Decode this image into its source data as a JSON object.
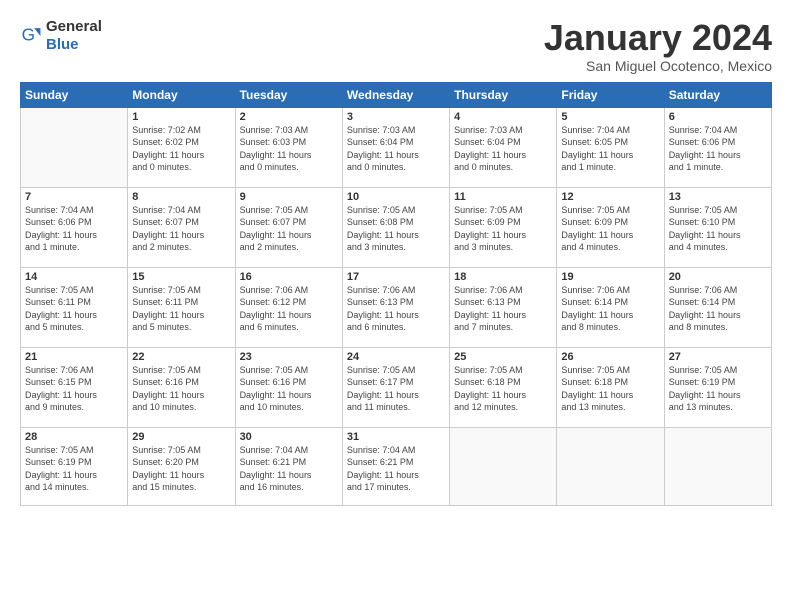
{
  "logo": {
    "general": "General",
    "blue": "Blue"
  },
  "title": "January 2024",
  "subtitle": "San Miguel Ocotenco, Mexico",
  "weekdays": [
    "Sunday",
    "Monday",
    "Tuesday",
    "Wednesday",
    "Thursday",
    "Friday",
    "Saturday"
  ],
  "weeks": [
    [
      {
        "day": "",
        "info": ""
      },
      {
        "day": "1",
        "info": "Sunrise: 7:02 AM\nSunset: 6:02 PM\nDaylight: 11 hours\nand 0 minutes."
      },
      {
        "day": "2",
        "info": "Sunrise: 7:03 AM\nSunset: 6:03 PM\nDaylight: 11 hours\nand 0 minutes."
      },
      {
        "day": "3",
        "info": "Sunrise: 7:03 AM\nSunset: 6:04 PM\nDaylight: 11 hours\nand 0 minutes."
      },
      {
        "day": "4",
        "info": "Sunrise: 7:03 AM\nSunset: 6:04 PM\nDaylight: 11 hours\nand 0 minutes."
      },
      {
        "day": "5",
        "info": "Sunrise: 7:04 AM\nSunset: 6:05 PM\nDaylight: 11 hours\nand 1 minute."
      },
      {
        "day": "6",
        "info": "Sunrise: 7:04 AM\nSunset: 6:06 PM\nDaylight: 11 hours\nand 1 minute."
      }
    ],
    [
      {
        "day": "7",
        "info": "Sunrise: 7:04 AM\nSunset: 6:06 PM\nDaylight: 11 hours\nand 1 minute."
      },
      {
        "day": "8",
        "info": "Sunrise: 7:04 AM\nSunset: 6:07 PM\nDaylight: 11 hours\nand 2 minutes."
      },
      {
        "day": "9",
        "info": "Sunrise: 7:05 AM\nSunset: 6:07 PM\nDaylight: 11 hours\nand 2 minutes."
      },
      {
        "day": "10",
        "info": "Sunrise: 7:05 AM\nSunset: 6:08 PM\nDaylight: 11 hours\nand 3 minutes."
      },
      {
        "day": "11",
        "info": "Sunrise: 7:05 AM\nSunset: 6:09 PM\nDaylight: 11 hours\nand 3 minutes."
      },
      {
        "day": "12",
        "info": "Sunrise: 7:05 AM\nSunset: 6:09 PM\nDaylight: 11 hours\nand 4 minutes."
      },
      {
        "day": "13",
        "info": "Sunrise: 7:05 AM\nSunset: 6:10 PM\nDaylight: 11 hours\nand 4 minutes."
      }
    ],
    [
      {
        "day": "14",
        "info": "Sunrise: 7:05 AM\nSunset: 6:11 PM\nDaylight: 11 hours\nand 5 minutes."
      },
      {
        "day": "15",
        "info": "Sunrise: 7:05 AM\nSunset: 6:11 PM\nDaylight: 11 hours\nand 5 minutes."
      },
      {
        "day": "16",
        "info": "Sunrise: 7:06 AM\nSunset: 6:12 PM\nDaylight: 11 hours\nand 6 minutes."
      },
      {
        "day": "17",
        "info": "Sunrise: 7:06 AM\nSunset: 6:13 PM\nDaylight: 11 hours\nand 6 minutes."
      },
      {
        "day": "18",
        "info": "Sunrise: 7:06 AM\nSunset: 6:13 PM\nDaylight: 11 hours\nand 7 minutes."
      },
      {
        "day": "19",
        "info": "Sunrise: 7:06 AM\nSunset: 6:14 PM\nDaylight: 11 hours\nand 8 minutes."
      },
      {
        "day": "20",
        "info": "Sunrise: 7:06 AM\nSunset: 6:14 PM\nDaylight: 11 hours\nand 8 minutes."
      }
    ],
    [
      {
        "day": "21",
        "info": "Sunrise: 7:06 AM\nSunset: 6:15 PM\nDaylight: 11 hours\nand 9 minutes."
      },
      {
        "day": "22",
        "info": "Sunrise: 7:05 AM\nSunset: 6:16 PM\nDaylight: 11 hours\nand 10 minutes."
      },
      {
        "day": "23",
        "info": "Sunrise: 7:05 AM\nSunset: 6:16 PM\nDaylight: 11 hours\nand 10 minutes."
      },
      {
        "day": "24",
        "info": "Sunrise: 7:05 AM\nSunset: 6:17 PM\nDaylight: 11 hours\nand 11 minutes."
      },
      {
        "day": "25",
        "info": "Sunrise: 7:05 AM\nSunset: 6:18 PM\nDaylight: 11 hours\nand 12 minutes."
      },
      {
        "day": "26",
        "info": "Sunrise: 7:05 AM\nSunset: 6:18 PM\nDaylight: 11 hours\nand 13 minutes."
      },
      {
        "day": "27",
        "info": "Sunrise: 7:05 AM\nSunset: 6:19 PM\nDaylight: 11 hours\nand 13 minutes."
      }
    ],
    [
      {
        "day": "28",
        "info": "Sunrise: 7:05 AM\nSunset: 6:19 PM\nDaylight: 11 hours\nand 14 minutes."
      },
      {
        "day": "29",
        "info": "Sunrise: 7:05 AM\nSunset: 6:20 PM\nDaylight: 11 hours\nand 15 minutes."
      },
      {
        "day": "30",
        "info": "Sunrise: 7:04 AM\nSunset: 6:21 PM\nDaylight: 11 hours\nand 16 minutes."
      },
      {
        "day": "31",
        "info": "Sunrise: 7:04 AM\nSunset: 6:21 PM\nDaylight: 11 hours\nand 17 minutes."
      },
      {
        "day": "",
        "info": ""
      },
      {
        "day": "",
        "info": ""
      },
      {
        "day": "",
        "info": ""
      }
    ]
  ]
}
